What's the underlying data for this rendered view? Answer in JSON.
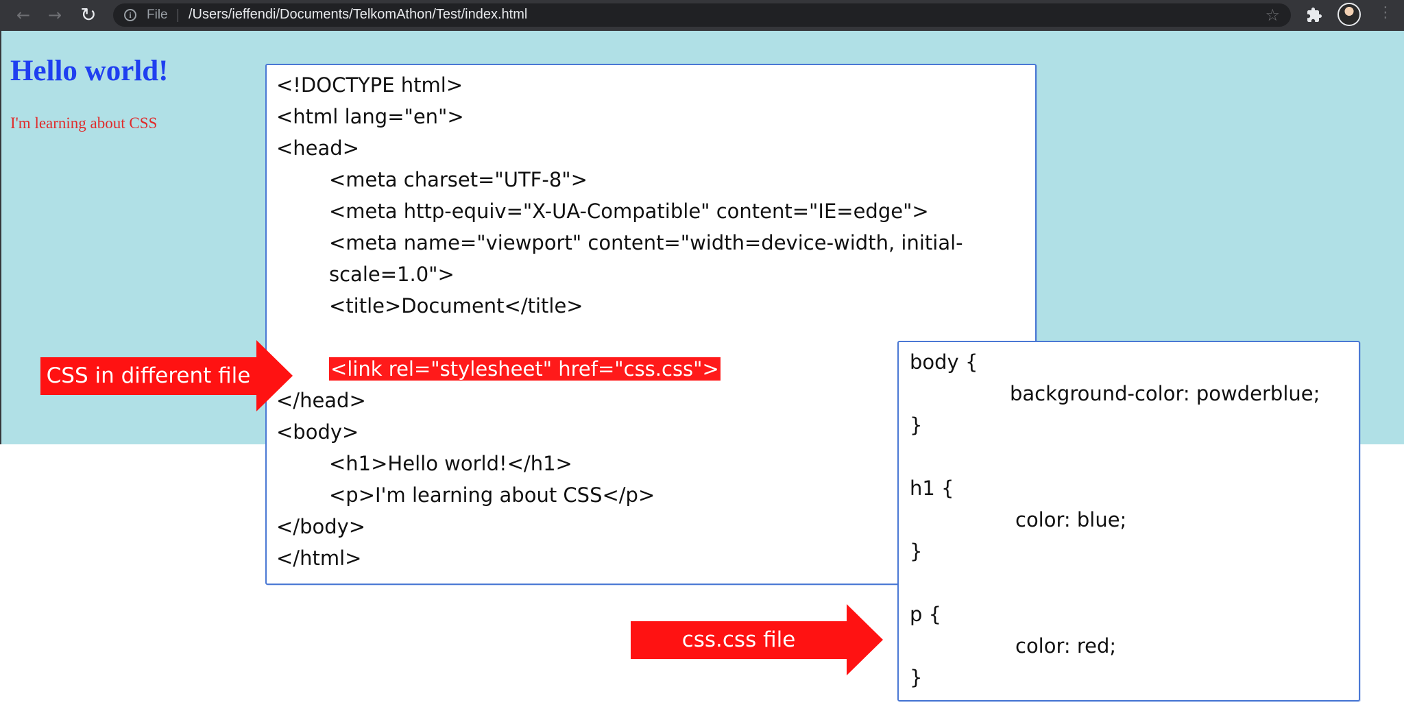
{
  "browser": {
    "url_scheme_label": "File",
    "url": "/Users/ieffendi/Documents/TelkomAthon/Test/index.html",
    "icons": [
      "back-arrow-icon",
      "forward-arrow-icon",
      "reload-icon",
      "info-icon",
      "star-icon",
      "puzzle-icon",
      "avatar",
      "kebab-menu-icon"
    ]
  },
  "page": {
    "background_color": "#b0e0e6",
    "heading": "Hello world!",
    "heading_color": "#1f3ff0",
    "paragraph": "I'm learning about CSS",
    "paragraph_color": "#e02b2b"
  },
  "html_snippet": {
    "lines": [
      "<!DOCTYPE html>",
      "<html lang=\"en\">",
      "<head>",
      "<meta charset=\"UTF-8\">",
      "<meta http-equiv=\"X-UA-Compatible\" content=\"IE=edge\">",
      "<meta name=\"viewport\" content=\"width=device-width, initial-",
      "scale=1.0\">",
      "<title>Document</title>",
      "<link rel=\"stylesheet\" href=\"css.css\">",
      "</head>",
      "<body>",
      "<h1>Hello world!</h1>",
      "<p>I'm learning about CSS</p>",
      "</body>",
      "</html>"
    ]
  },
  "css_snippet": {
    "lines": [
      "body {",
      "background-color: powderblue;",
      "}",
      "h1 {",
      "color: blue;",
      "}",
      "p {",
      "color: red;",
      "}"
    ]
  },
  "annotations": {
    "arrow_1_label": "CSS in different file",
    "arrow_2_label": "css.css file",
    "arrow_color": "#ff1212"
  }
}
